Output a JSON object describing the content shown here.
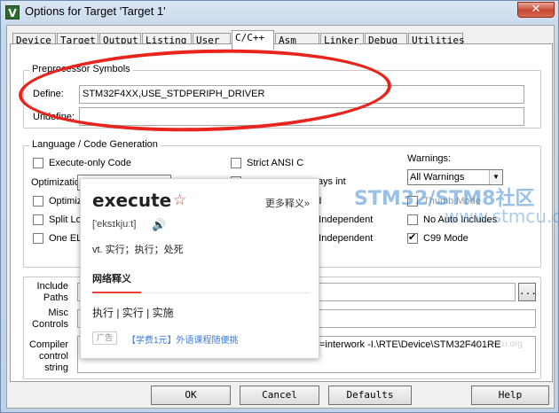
{
  "window": {
    "title": "Options for Target 'Target 1'",
    "app_icon": "uvision-icon",
    "close_glyph": "✕"
  },
  "tabs": [
    {
      "label": "Device"
    },
    {
      "label": "Target"
    },
    {
      "label": "Output"
    },
    {
      "label": "Listing"
    },
    {
      "label": "User"
    },
    {
      "label": "C/C++",
      "active": true
    },
    {
      "label": "Asm"
    },
    {
      "label": "Linker"
    },
    {
      "label": "Debug"
    },
    {
      "label": "Utilities"
    }
  ],
  "preprocessor": {
    "group_label": "Preprocessor Symbols",
    "define_label": "Define:",
    "define_value": "STM32F4XX,USE_STDPERIPH_DRIVER",
    "undefine_label": "Undefine:",
    "undefine_value": ""
  },
  "language": {
    "group_label": "Language / Code Generation",
    "execute_only": {
      "label": "Execute-only Code",
      "checked": false
    },
    "optimization_label": "Optimization",
    "optimize_for_time": {
      "label": "Optimize",
      "checked": false
    },
    "split_load": {
      "label": "Split Lo",
      "checked": false
    },
    "one_elf": {
      "label": "One EL",
      "checked": false
    },
    "strict_ansi": {
      "label": "Strict ANSI C",
      "checked": false
    },
    "enum_container": {
      "label": "ways int",
      "checked": false
    },
    "plain_char": {
      "label": "ed",
      "checked": false
    },
    "read_only_pi": {
      "label": "n Independent",
      "checked": false
    },
    "read_write_pi": {
      "label": "n Independent",
      "checked": false
    },
    "warnings_label": "Warnings:",
    "warnings_value": "All Warnings",
    "thumb_mode": {
      "label": "Thumb Mode",
      "checked": false
    },
    "no_auto_includes": {
      "label": "No Auto Includes",
      "checked": false
    },
    "c99_mode": {
      "label": "C99 Mode",
      "checked": true
    }
  },
  "paths": {
    "include_label": "Include\nPaths",
    "include_value": "",
    "browse_label": "...",
    "misc_label": "Misc\nControls",
    "misc_value": "",
    "compiler_label": "Compiler\ncontrol\nstring",
    "compiler_value": "=interwork -I.\\RTE\\Device\\STM32F401RE"
  },
  "buttons": {
    "ok": "OK",
    "cancel": "Cancel",
    "defaults": "Defaults",
    "help": "Help"
  },
  "popup": {
    "word": "execute",
    "more": "更多释义»",
    "phonetic": "['eksɪkjuːt]",
    "definition": "vt. 实行；执行；处死",
    "tab_label": "网络释义",
    "meanings": "执行 | 实行 | 实施",
    "ad_badge": "广告",
    "ad_text": "【学费1元】外语课程随便挑"
  },
  "watermark": {
    "main": "STM32/STM8社区",
    "sub": "www.stmcu.org",
    "faint": "www.stmcu.org"
  },
  "colors": {
    "annotation_red": "#e8241d",
    "popup_accent": "#e8433a",
    "ad_link": "#3b7bd6"
  }
}
